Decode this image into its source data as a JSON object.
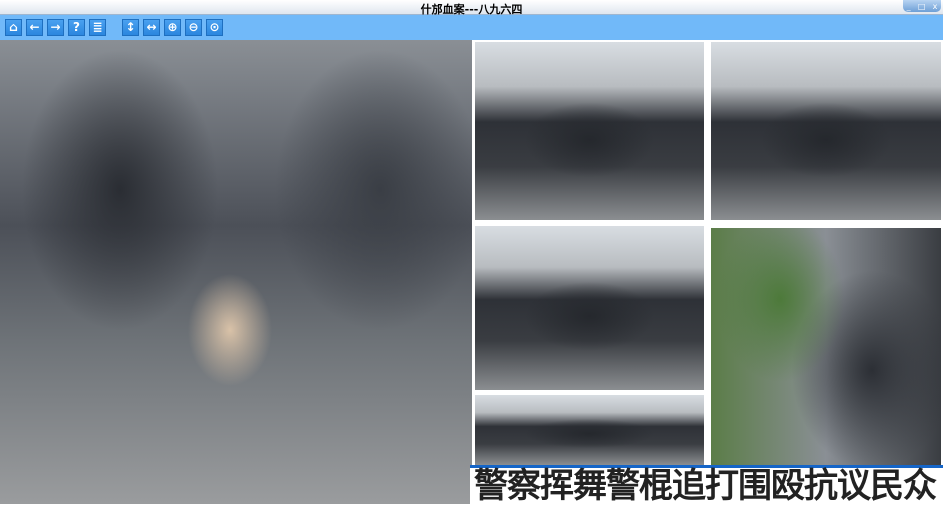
{
  "window": {
    "title": "什邡血案---八九六四",
    "controls": [
      "_",
      "□",
      "x"
    ]
  },
  "toolbar": {
    "buttons": [
      {
        "name": "home",
        "glyph": "⌂"
      },
      {
        "name": "back",
        "glyph": "←"
      },
      {
        "name": "forward",
        "glyph": "→"
      },
      {
        "name": "help",
        "glyph": "?"
      },
      {
        "name": "contents",
        "glyph": "≣"
      },
      {
        "name": "fit-height",
        "glyph": "↕"
      },
      {
        "name": "fit-width",
        "glyph": "↔"
      },
      {
        "name": "zoom-in",
        "glyph": "⊕"
      },
      {
        "name": "zoom-out",
        "glyph": "⊖"
      },
      {
        "name": "zoom-actual",
        "glyph": "⊙"
      }
    ]
  },
  "content": {
    "caption": "警察挥舞警棍追打围殴抗议民众"
  }
}
